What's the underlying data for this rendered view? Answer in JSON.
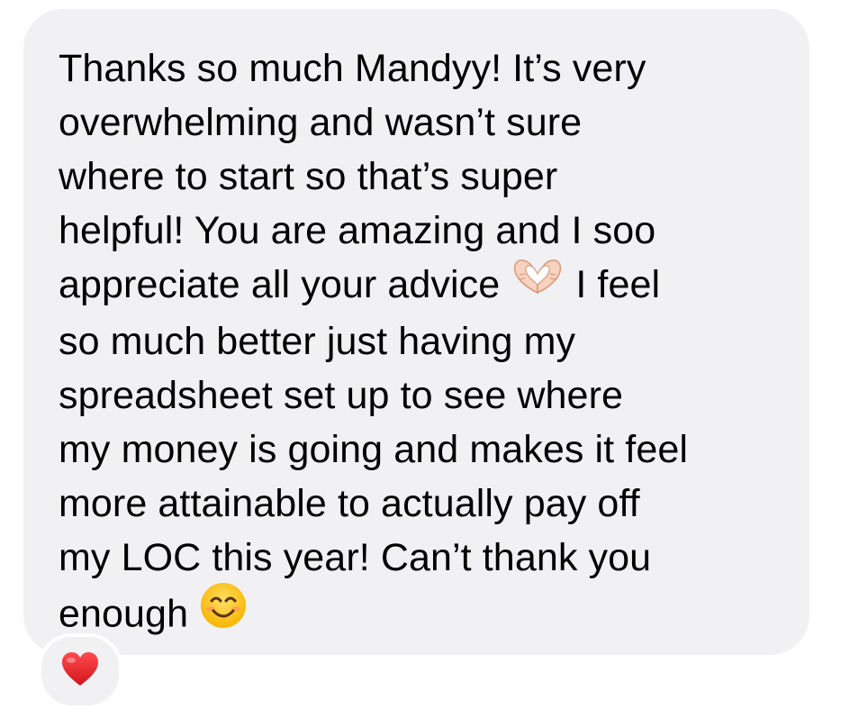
{
  "message": {
    "lines": [
      "Thanks so much Mandyy! It’s very",
      "overwhelming and wasn’t sure",
      "where to start so that’s super",
      "helpful! You are amazing and I soo",
      "appreciate all your advice",
      "I feel",
      "so much better just having my",
      "spreadsheet set up to see where",
      "my money is going and makes it feel",
      "more attainable to actually pay off",
      "my LOC this year! Can’t thank you",
      "enough"
    ],
    "inline_emojis": [
      "heart-hands-icon",
      "smiling-face-icon"
    ],
    "bubble_color": "#f1f1f4",
    "text_color": "#000000"
  },
  "reaction": {
    "icon": "red-heart-icon",
    "color": "#e0242c"
  }
}
